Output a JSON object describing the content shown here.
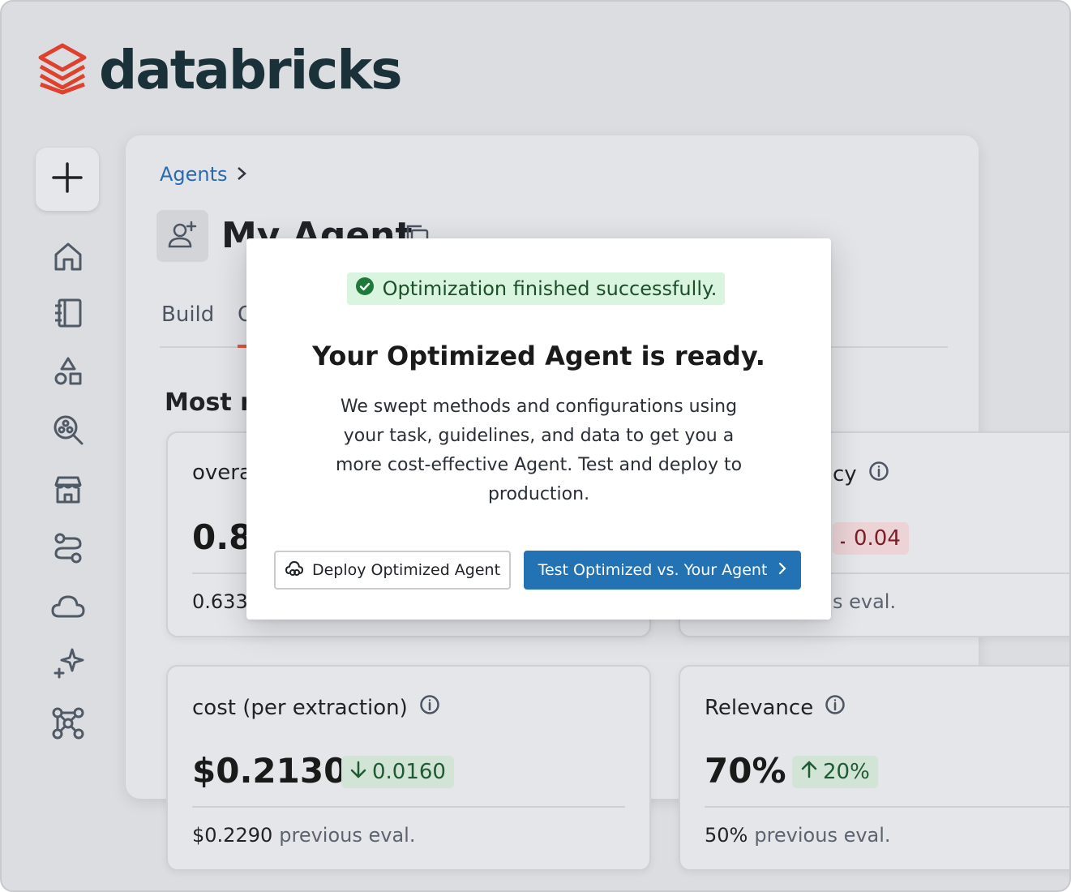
{
  "brand": {
    "name": "databricks",
    "color": "#e0412d"
  },
  "sidebar": {
    "new_icon": "plus-icon",
    "items": [
      {
        "icon": "home-icon"
      },
      {
        "icon": "notebook-icon"
      },
      {
        "icon": "shapes-icon"
      },
      {
        "icon": "search-data-icon"
      },
      {
        "icon": "marketplace-icon"
      },
      {
        "icon": "workflow-icon"
      },
      {
        "icon": "cloud-icon"
      },
      {
        "icon": "sparkle-icon"
      },
      {
        "icon": "graph-icon"
      }
    ]
  },
  "main": {
    "breadcrumb": "Agents",
    "agent_title": "My Agent",
    "tabs": [
      {
        "label": "Build"
      },
      {
        "label": "O"
      }
    ],
    "section_title": "Most r",
    "cards": [
      {
        "label": "overa",
        "value": "0.8",
        "prev_value": "0.633",
        "prev_label": ""
      },
      {
        "label": "cy",
        "delta": "0.04",
        "delta_dir": "down",
        "prev_value": "",
        "prev_label": "s eval."
      },
      {
        "label": "cost (per extraction)",
        "value": "$0.2130",
        "delta": "0.0160",
        "delta_dir": "down",
        "prev_value": "$0.2290",
        "prev_label": "previous eval."
      },
      {
        "label": "Relevance",
        "value": "70%",
        "delta": "20%",
        "delta_dir": "up",
        "prev_value": "50%",
        "prev_label": "previous eval."
      }
    ]
  },
  "modal": {
    "status": "Optimization finished successfully.",
    "title": "Your Optimized Agent is ready.",
    "body": "We swept methods and configurations using your task, guidelines, and data to get you a more cost-effective Agent. Test and deploy to production.",
    "secondary_button": "Deploy Optimized Agent",
    "primary_button": "Test Optimized vs. Your Agent"
  },
  "colors": {
    "primary": "#2272b4",
    "success_bg": "#daf5df",
    "success_icon": "#1f7a3a",
    "accent_tab": "#e0543c"
  }
}
